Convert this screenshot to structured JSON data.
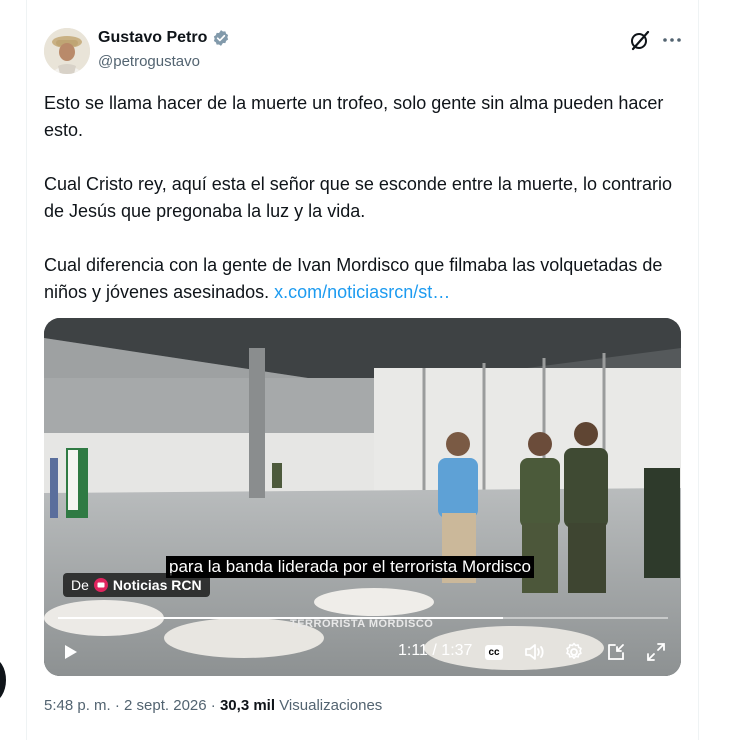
{
  "author": {
    "name": "Gustavo Petro",
    "handle": "@petrogustavo"
  },
  "tweet": {
    "paragraphs": [
      "Esto se llama hacer de la muerte un trofeo, solo gente sin alma pueden hacer esto.",
      "Cual Cristo rey, aquí esta el señor que se esconde entre la muerte, lo contrario de Jesús que pregonaba la luz y la vida.",
      "Cual diferencia con la gente de Ivan Mordisco que filmaba las volquetadas de niños y jóvenes asesinados. "
    ],
    "link_text": "x.com/noticiasrcn/st…"
  },
  "video": {
    "caption": "para la banda liderada por el terrorista Mordisco",
    "source_prefix": "De",
    "source_name": "Noticias RCN",
    "burned_label": "TERRORISTA MORDISCO",
    "time": "1:11 / 1:37",
    "progress": 0.73,
    "cc_label": "cc"
  },
  "meta": {
    "time": "5:48 p. m.",
    "sep": " · ",
    "date": "2 sept. 2026",
    "views_count": "30,3 mil",
    "views_label": "Visualizaciones"
  },
  "icons": {
    "verified": "verified-badge-icon",
    "grok": "grok-icon",
    "more": "more-icon"
  },
  "colors": {
    "link": "#1d9bf0",
    "secondary_text": "#536471"
  }
}
